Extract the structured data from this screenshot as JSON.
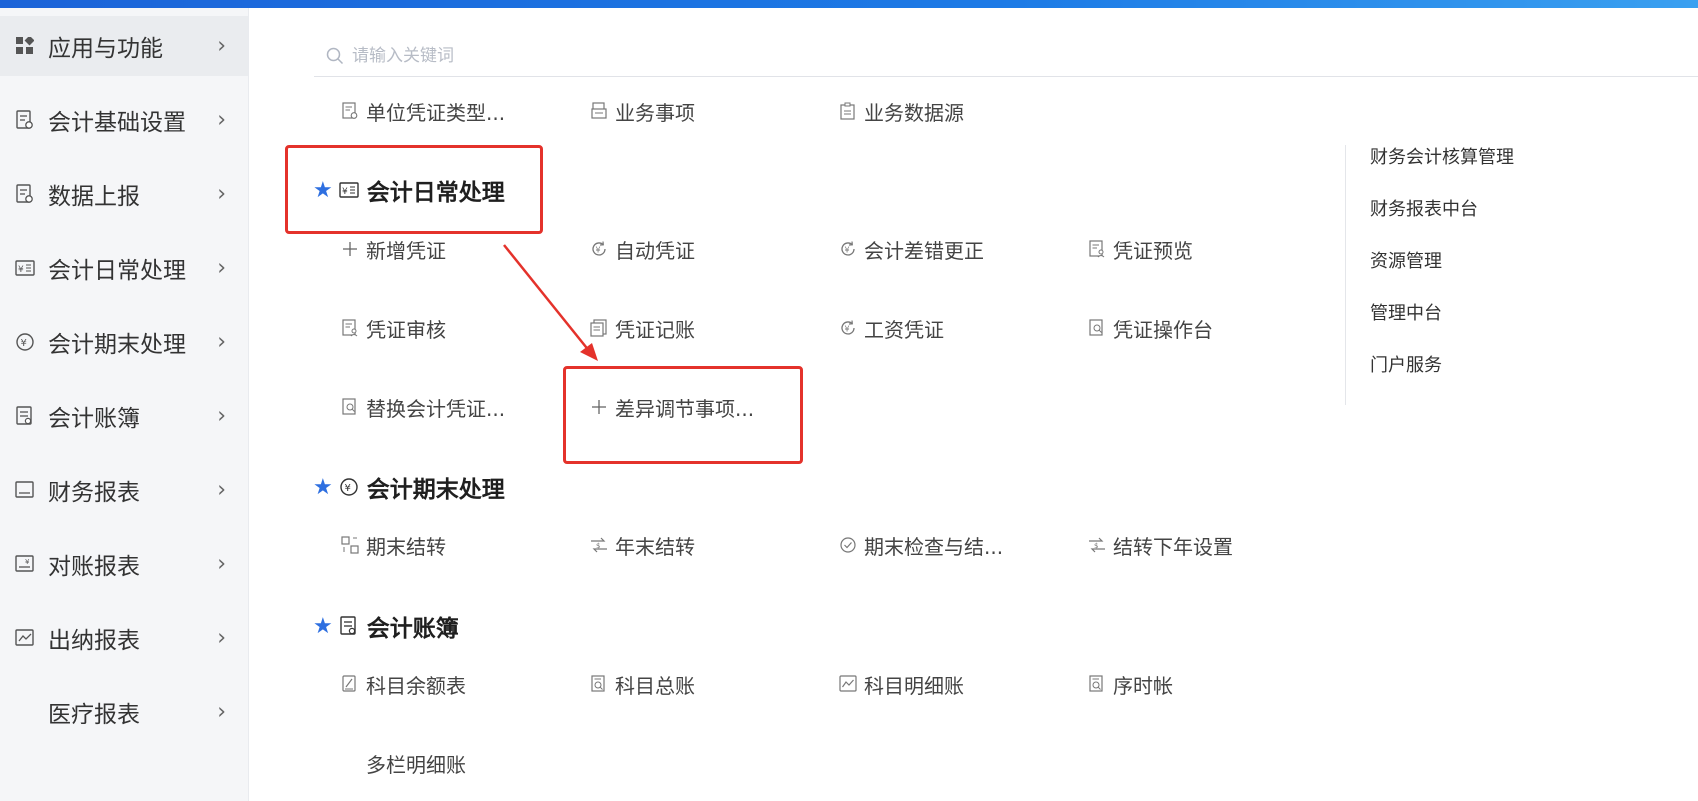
{
  "sidebar": {
    "items": [
      {
        "label": "应用与功能",
        "icon": "grid-icon"
      },
      {
        "label": "会计基础设置",
        "icon": "doc-settings-icon"
      },
      {
        "label": "数据上报",
        "icon": "doc-upload-icon"
      },
      {
        "label": "会计日常处理",
        "icon": "yen-card-icon"
      },
      {
        "label": "会计期末处理",
        "icon": "yen-circle-icon"
      },
      {
        "label": "会计账簿",
        "icon": "ledger-icon"
      },
      {
        "label": "财务报表",
        "icon": "report-icon"
      },
      {
        "label": "对账报表",
        "icon": "report-yen-icon"
      },
      {
        "label": "出纳报表",
        "icon": "line-chart-icon"
      },
      {
        "label": "医疗报表",
        "icon": ""
      }
    ]
  },
  "search": {
    "placeholder": "请输入关键词"
  },
  "top_row": [
    {
      "label": "单位凭证类型...",
      "icon": "doc-settings-icon"
    },
    {
      "label": "业务事项",
      "icon": "stack-doc-icon"
    },
    {
      "label": "业务数据源",
      "icon": "clipboard-icon"
    }
  ],
  "sections": [
    {
      "title": "会计日常处理",
      "icon": "yen-card-icon",
      "items": [
        {
          "label": "新增凭证",
          "icon": "plus-icon"
        },
        {
          "label": "自动凭证",
          "icon": "refresh-yen-icon"
        },
        {
          "label": "会计差错更正",
          "icon": "refresh-yen-icon"
        },
        {
          "label": "凭证预览",
          "icon": "doc-user-icon"
        },
        {
          "label": "凭证审核",
          "icon": "doc-user-icon"
        },
        {
          "label": "凭证记账",
          "icon": "docs-icon"
        },
        {
          "label": "工资凭证",
          "icon": "refresh-yen-icon"
        },
        {
          "label": "凭证操作台",
          "icon": "doc-search-icon"
        },
        {
          "label": "替换会计凭证...",
          "icon": "doc-search-icon"
        },
        {
          "label": "差异调节事项...",
          "icon": "plus-icon"
        }
      ]
    },
    {
      "title": "会计期末处理",
      "icon": "yen-circle-icon",
      "items": [
        {
          "label": "期末结转",
          "icon": "transfer-icon"
        },
        {
          "label": "年末结转",
          "icon": "dollar-transfer-icon"
        },
        {
          "label": "期末检查与结...",
          "icon": "check-circle-icon"
        },
        {
          "label": "结转下年设置",
          "icon": "dollar-transfer-icon"
        }
      ]
    },
    {
      "title": "会计账簿",
      "icon": "ledger-icon",
      "items": [
        {
          "label": "科目余额表",
          "icon": "doc-pen-icon"
        },
        {
          "label": "科目总账",
          "icon": "doc-search-icon"
        },
        {
          "label": "科目明细账",
          "icon": "line-chart-icon"
        },
        {
          "label": "序时帐",
          "icon": "doc-search-icon"
        },
        {
          "label": "多栏明细账",
          "icon": ""
        }
      ]
    }
  ],
  "right_links": [
    "财务会计核算管理",
    "财务报表中台",
    "资源管理",
    "管理中台",
    "门户服务"
  ],
  "colors": {
    "accent": "#2e6fe0",
    "annotation": "#e4322b",
    "topbar": "#1b63d8"
  }
}
